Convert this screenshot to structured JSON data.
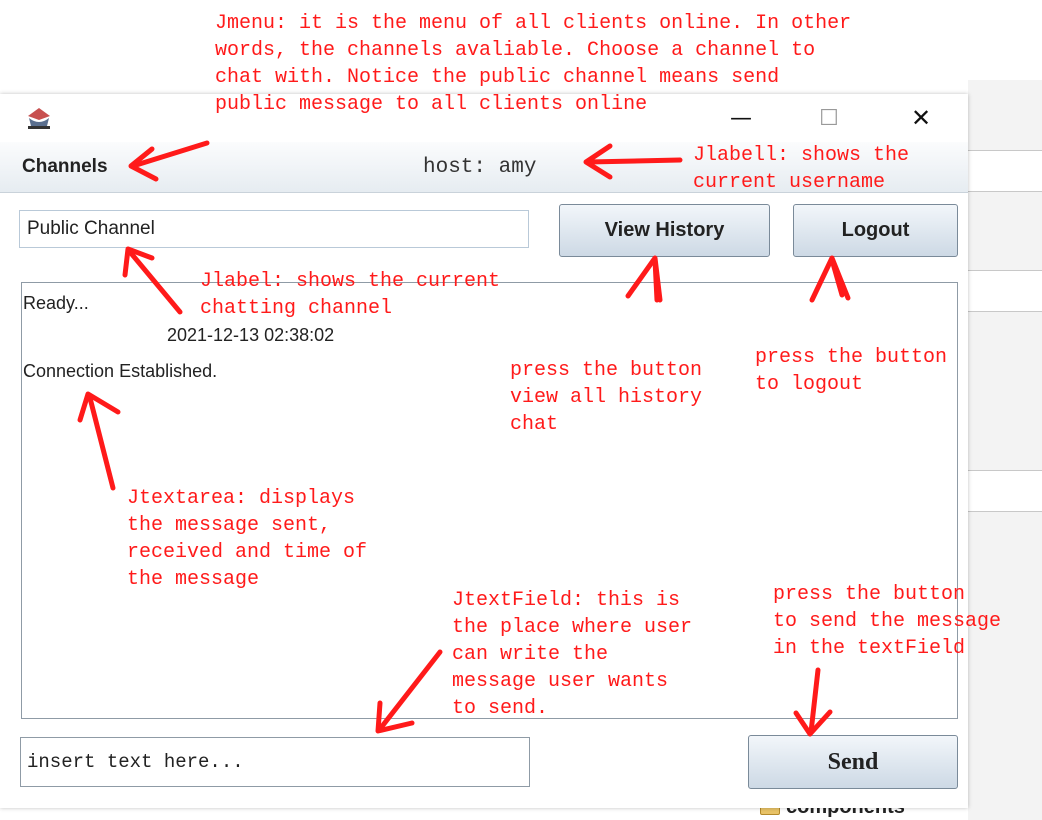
{
  "window": {
    "minimize_glyph": "—",
    "maximize_glyph": "☐",
    "close_glyph": "✕",
    "app_icon": "java-cup-icon"
  },
  "menubar": {
    "channels_label": "Channels",
    "host_label": "host: amy"
  },
  "channel_field": {
    "value": "Public Channel"
  },
  "buttons": {
    "view_history": "View History",
    "logout": "Logout",
    "send": "Send"
  },
  "chat": {
    "messages": [
      {
        "text": "Ready...",
        "timestamp": "2021-12-13 02:38:02"
      },
      {
        "text": "Connection Established."
      }
    ]
  },
  "input": {
    "placeholder": "insert text here..."
  },
  "background": {
    "folder_label": "components"
  },
  "annotations": {
    "jmenu": "Jmenu: it is the menu of all clients online. In other\nwords, the channels avaliable. Choose a channel to\nchat with. Notice the public channel means send\npublic message to all clients online",
    "jlabel_user": "Jlabell: shows the\ncurrent username",
    "jlabel_channel": "Jlabel: shows the current\nchatting channel",
    "view_history": "press the button\nview all history\nchat",
    "logout": "press the button\nto logout",
    "textarea": "Jtextarea: displays\nthe message sent,\nreceived and time of\nthe message",
    "textfield": "JtextField: this is\nthe place where user\ncan write the\nmessage user wants\nto send.",
    "send": "press the button\nto send the message\nin the textField"
  },
  "colors": {
    "annotation": "#ff1a1a",
    "button_top": "#f2f6fa",
    "button_bottom": "#cdd9e5",
    "menubar_bottom": "#e6ecf1"
  }
}
